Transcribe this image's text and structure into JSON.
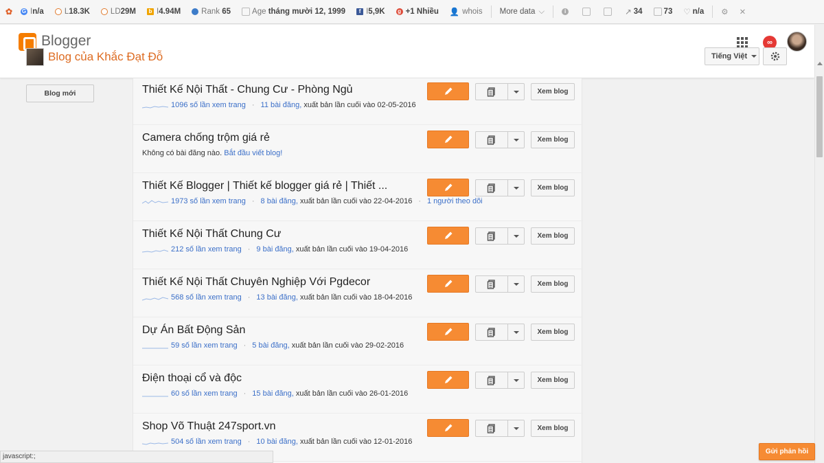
{
  "seo_toolbar": {
    "google": {
      "label": "I",
      "value": "n/a"
    },
    "links": {
      "label": "L",
      "value": "18.3K"
    },
    "linking_domains": {
      "label": "LD",
      "value": "29M"
    },
    "bing_index": {
      "label": "I",
      "value": "4.94M"
    },
    "rank": {
      "label": "Rank",
      "value": "65"
    },
    "age": {
      "label": "Age",
      "value": "tháng mười 12, 1999"
    },
    "facebook": {
      "label": "I",
      "value": "5,9K"
    },
    "gplus": {
      "label": "+1",
      "value": "Nhiều"
    },
    "whois_label": "whois",
    "more_data_label": "More data",
    "external_links": "34",
    "internal_links": "73",
    "love": "n/a"
  },
  "header": {
    "logo_text": "Blogger",
    "blog_title": "Blog của Khắc Đạt Đỗ",
    "language_label": "Tiếng Việt",
    "notification_badge": "∞"
  },
  "sidebar": {
    "new_blog_label": "Blog mới"
  },
  "buttons": {
    "view_blog_label": "Xem blog"
  },
  "blogs": [
    {
      "name": "Thiết Kế Nội Thất - Chung Cư - Phòng Ngủ",
      "views": "1096 số lần xem trang",
      "posts": "11 bài đăng,",
      "published": "xuất bản lần cuối vào 02-05-2016",
      "followers": ""
    },
    {
      "name": "Camera chống trộm giá rẻ",
      "empty_text": "Không có bài đăng nào.",
      "start_link": "Bắt đầu viết blog!"
    },
    {
      "name": "Thiết Kế Blogger | Thiết kế blogger giá rẻ | Thiết ...",
      "views": "1973 số lần xem trang",
      "posts": "8 bài đăng,",
      "published": "xuất bản lần cuối vào 22-04-2016",
      "followers": "1 người theo dõi"
    },
    {
      "name": "Thiết Kế Nội Thất Chung Cư",
      "views": "212 số lần xem trang",
      "posts": "9 bài đăng,",
      "published": "xuất bản lần cuối vào 19-04-2016",
      "followers": ""
    },
    {
      "name": "Thiết Kế Nội Thất Chuyên Nghiệp Với Pgdecor",
      "views": "568 số lần xem trang",
      "posts": "13 bài đăng,",
      "published": "xuất bản lần cuối vào 18-04-2016",
      "followers": ""
    },
    {
      "name": "Dự Án Bất Động Sản",
      "views": "59 số lần xem trang",
      "posts": "5 bài đăng,",
      "published": "xuất bản lần cuối vào 29-02-2016",
      "followers": ""
    },
    {
      "name": "Điện thoại cổ và độc",
      "views": "60 số lần xem trang",
      "posts": "15 bài đăng,",
      "published": "xuất bản lần cuối vào 26-01-2016",
      "followers": ""
    },
    {
      "name": "Shop Võ Thuật 247sport.vn",
      "views": "504 số lần xem trang",
      "posts": "10 bài đăng,",
      "published": "xuất bản lần cuối vào 12-01-2016",
      "followers": ""
    }
  ],
  "status_bar": "javascript:;",
  "feedback_label": "Gửi phản hồi",
  "colors": {
    "accent": "#f68b33",
    "link": "#3b6fc8",
    "title": "#dd6b21"
  }
}
